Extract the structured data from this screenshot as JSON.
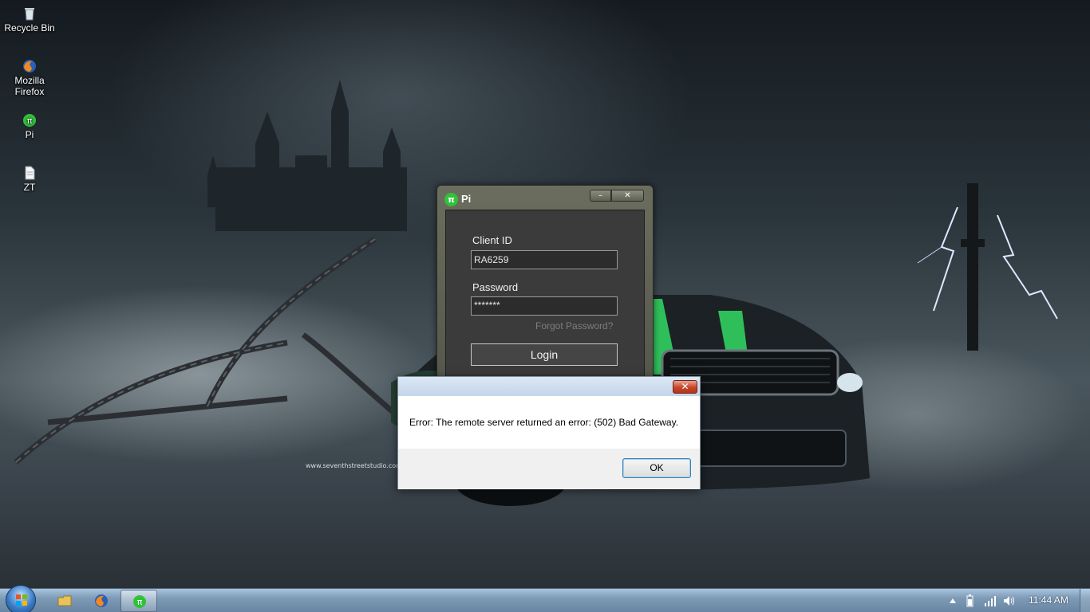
{
  "desktop": {
    "icons": [
      {
        "label": "Recycle Bin",
        "icon": "recycle-bin-icon"
      },
      {
        "label": "Mozilla Firefox",
        "icon": "firefox-icon"
      },
      {
        "label": "Pi",
        "icon": "pi-app-icon"
      },
      {
        "label": "ZT",
        "icon": "document-icon"
      }
    ],
    "watermark": "www.seventhstreetstudio.com"
  },
  "pi_window": {
    "title": "Pi",
    "logo": "π",
    "minimize_label": "–",
    "close_label": "✕",
    "client_id_label": "Client ID",
    "client_id_value": "RA6259",
    "password_label": "Password",
    "password_value": "*******",
    "forgot_label": "Forgot Password?",
    "login_label": "Login"
  },
  "error_dialog": {
    "close_label": "✕",
    "message": "Error: The remote server returned an error: (502) Bad Gateway.",
    "ok_label": "OK"
  },
  "taskbar": {
    "clock": "11:44 AM",
    "buttons": [
      {
        "icon": "file-explorer-icon"
      },
      {
        "icon": "firefox-icon"
      },
      {
        "icon": "pi-app-icon",
        "active": true
      }
    ],
    "tray_icons": [
      "show-hidden-icons-arrow-icon",
      "battery-icon",
      "network-signal-icon",
      "volume-icon"
    ]
  },
  "colors": {
    "pi_accent": "#31c13a",
    "car_stripe": "#2fbf5a"
  }
}
